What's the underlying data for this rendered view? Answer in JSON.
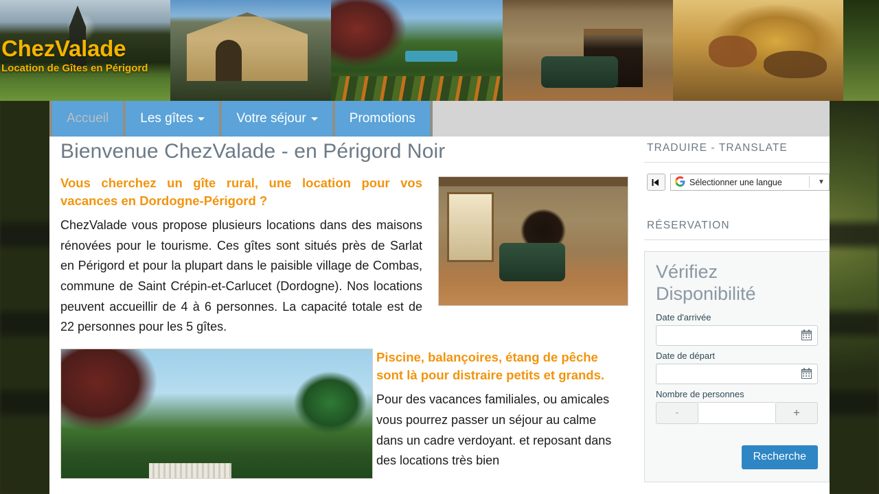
{
  "site": {
    "title": "ChezValade",
    "tagline": "Location de Gîtes en Périgord",
    "title_color": "#f5b400"
  },
  "nav": {
    "accent_color": "#5ba3d9",
    "items": [
      {
        "label": "Accueil",
        "active": true,
        "has_caret": false
      },
      {
        "label": "Les gîtes",
        "active": false,
        "has_caret": true
      },
      {
        "label": "Votre séjour",
        "active": false,
        "has_caret": true
      },
      {
        "label": "Promotions",
        "active": false,
        "has_caret": false
      }
    ]
  },
  "main": {
    "page_title": "Bienvenue ChezValade - en Périgord Noir",
    "intro": {
      "lead": "Vous cherchez un gîte rural, une location pour vos vacances en Dordogne-Périgord ?",
      "body": "ChezValade vous propose plusieurs locations dans des maisons rénovées pour le tourisme. Ces gîtes sont situés près de Sarlat en Périgord  et pour la plupart dans le paisible village de Combas, commune de Saint Crépin-et-Carlucet (Dordogne).  Nos locations peuvent accueillir de 4 à 6 personnes. La capacité totale est de 22 personnes pour les 5 gîtes.",
      "photo_name": "salon-cheminee-photo"
    },
    "second": {
      "lead": "Piscine, balançoires, étang de pêche sont là pour distraire petits et grands.",
      "body": "Pour des vacances familiales, ou amicales vous pourrez passer un séjour au  calme dans un cadre verdoyant.  et reposant dans des locations très bien",
      "photo_name": "jardin-piscine-photo"
    },
    "lead_color": "#f2940d"
  },
  "sidebar": {
    "translate": {
      "heading": "TRADUIRE - TRANSLATE",
      "collapse_icon": "collapse-left-icon",
      "google_icon": "google-g-icon",
      "selected_language": "Sélectionner une langue",
      "dropdown_icon": "chevron-down-icon"
    },
    "reservation": {
      "heading": "RÉSERVATION",
      "box_title": "Vérifiez Disponibilité",
      "arrival_label": "Date d'arrivée",
      "arrival_value": "",
      "departure_label": "Date de départ",
      "departure_value": "",
      "guests_label": "Nombre de personnes",
      "guests_value": "",
      "minus_label": "-",
      "plus_label": "+",
      "search_label": "Recherche",
      "search_color": "#2e86c4",
      "calendar_icon": "calendar-icon"
    }
  }
}
